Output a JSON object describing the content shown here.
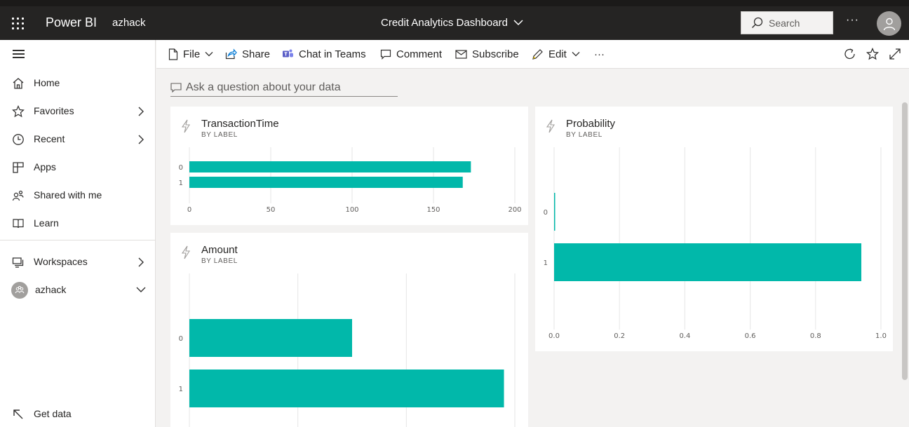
{
  "header": {
    "brand": "Power BI",
    "workspace": "azhack",
    "dashboard_title": "Credit Analytics Dashboard",
    "search_placeholder": "Search",
    "more": "···"
  },
  "sidebar": {
    "items": [
      {
        "label": "Home",
        "icon": "home-icon"
      },
      {
        "label": "Favorites",
        "icon": "star-icon"
      },
      {
        "label": "Recent",
        "icon": "clock-icon"
      },
      {
        "label": "Apps",
        "icon": "apps-icon"
      },
      {
        "label": "Shared with me",
        "icon": "shared-icon"
      },
      {
        "label": "Learn",
        "icon": "book-icon"
      },
      {
        "label": "Workspaces",
        "icon": "workspaces-icon"
      },
      {
        "label": "azhack",
        "icon": "workspace-avatar-icon"
      }
    ],
    "get_data": "Get data"
  },
  "actionbar": {
    "file": "File",
    "share": "Share",
    "chat_in_teams": "Chat in Teams",
    "comment": "Comment",
    "subscribe": "Subscribe",
    "edit": "Edit",
    "more": "···"
  },
  "qna": {
    "placeholder": "Ask a question about your data"
  },
  "tiles": [
    {
      "title": "TransactionTime",
      "subtitle": "BY LABEL"
    },
    {
      "title": "Probability",
      "subtitle": "BY LABEL"
    },
    {
      "title": "Amount",
      "subtitle": "BY LABEL"
    }
  ],
  "colors": {
    "bar": "#01b8aa",
    "topbar": "#252423"
  },
  "chart_data": [
    {
      "type": "bar",
      "orientation": "horizontal",
      "title": "TransactionTime",
      "subtitle": "BY LABEL",
      "categories": [
        "0",
        "1"
      ],
      "values": [
        173,
        168
      ],
      "xlim": [
        0,
        200
      ],
      "xticks": [
        "0",
        "50",
        "100",
        "150",
        "200"
      ],
      "grid": true
    },
    {
      "type": "bar",
      "orientation": "horizontal",
      "title": "Probability",
      "subtitle": "BY LABEL",
      "categories": [
        "0",
        "1"
      ],
      "values": [
        0.003,
        0.94
      ],
      "xlim": [
        0,
        1.0
      ],
      "xticks": [
        "0.0",
        "0.2",
        "0.4",
        "0.6",
        "0.8",
        "1.0"
      ],
      "grid": true
    },
    {
      "type": "bar",
      "orientation": "horizontal",
      "title": "Amount",
      "subtitle": "BY LABEL",
      "categories": [
        "0",
        "1"
      ],
      "values": [
        75,
        145
      ],
      "xlim": [
        0,
        150
      ],
      "grid": true
    }
  ]
}
